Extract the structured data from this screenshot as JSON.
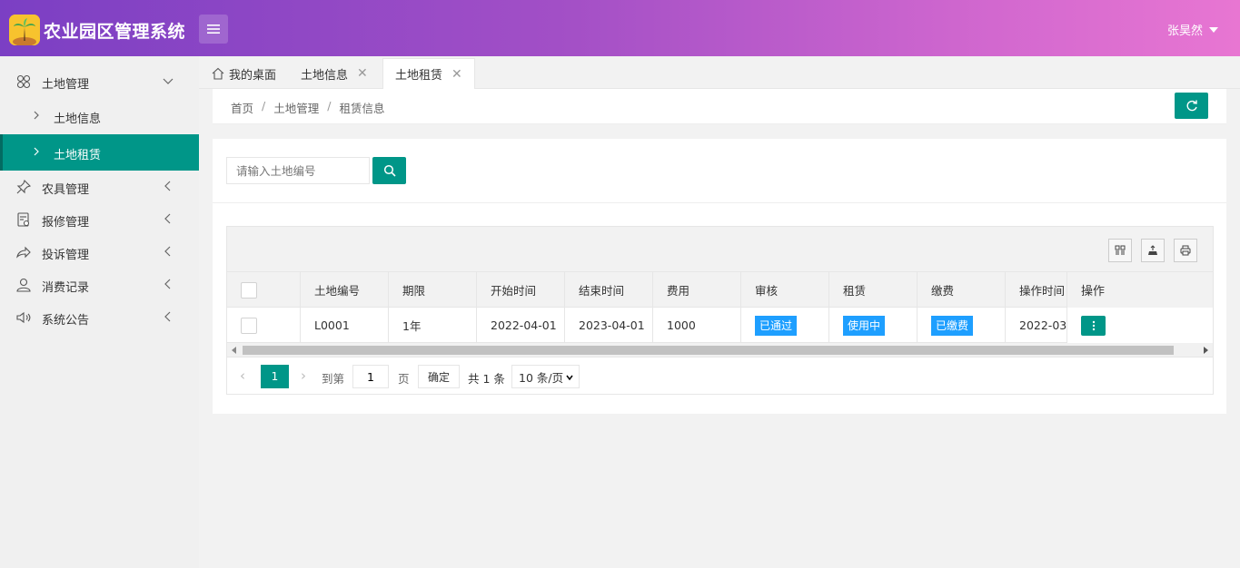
{
  "header": {
    "app_title": "农业园区管理系统",
    "user_name": "张昊然"
  },
  "sidebar": {
    "items": [
      {
        "label": "土地管理",
        "icon": "clover-icon",
        "expanded": true,
        "children": [
          {
            "label": "土地信息"
          },
          {
            "label": "土地租赁",
            "active": true
          }
        ]
      },
      {
        "label": "农具管理",
        "icon": "pin-icon"
      },
      {
        "label": "报修管理",
        "icon": "repair-icon"
      },
      {
        "label": "投诉管理",
        "icon": "share-icon"
      },
      {
        "label": "消费记录",
        "icon": "user-icon"
      },
      {
        "label": "系统公告",
        "icon": "speaker-icon"
      }
    ]
  },
  "tabs": [
    {
      "label": "我的桌面",
      "icon": "home-icon"
    },
    {
      "label": "土地信息",
      "closable": true
    },
    {
      "label": "土地租赁",
      "closable": true,
      "active": true
    }
  ],
  "breadcrumb": {
    "items": [
      "首页",
      "土地管理",
      "租赁信息"
    ],
    "separator": "/"
  },
  "search": {
    "placeholder": "请输入土地编号"
  },
  "table": {
    "columns": [
      "土地编号",
      "期限",
      "开始时间",
      "结束时间",
      "费用",
      "审核",
      "租赁",
      "缴费",
      "操作时间",
      "操作"
    ],
    "rows": [
      {
        "code": "L0001",
        "term": "1年",
        "start": "2022-04-01",
        "end": "2023-04-01",
        "fee": "1000",
        "audit": "已通过",
        "lease": "使用中",
        "payment": "已缴费",
        "op_time": "2022-03-..."
      }
    ]
  },
  "pagination": {
    "current_page": "1",
    "goto_label": "到第",
    "goto_value": "1",
    "page_label": "页",
    "confirm_label": "确定",
    "total_label": "共 1 条",
    "page_size": "10 条/页"
  },
  "colors": {
    "header_gradient_start": "#7b3fc4",
    "header_gradient_end": "#e876d2",
    "primary": "#009688",
    "badge": "#1e9fff"
  }
}
